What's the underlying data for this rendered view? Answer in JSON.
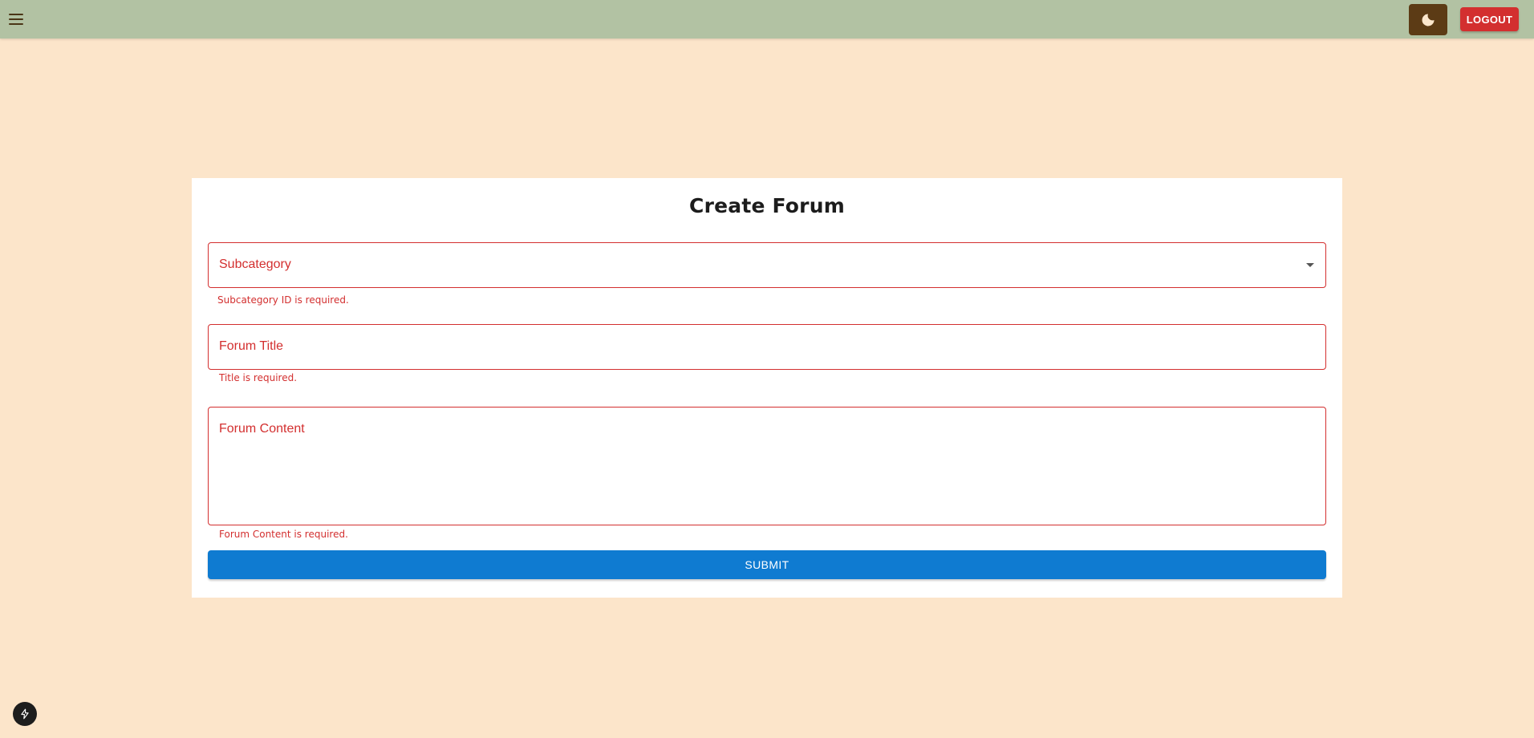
{
  "header": {
    "menu_icon": "hamburger-menu-icon",
    "theme_icon": "moon-icon",
    "logout_label": "LOGOUT",
    "background": "#b2c2a3",
    "theme_button_color": "#5c3b15",
    "logout_color": "#d32f2f"
  },
  "form": {
    "title": "Create Forum",
    "subcategory": {
      "label": "Subcategory",
      "value": "",
      "error": "Subcategory ID is required."
    },
    "forum_title": {
      "label": "Forum Title",
      "value": "",
      "error": "Title is required."
    },
    "forum_content": {
      "label": "Forum Content",
      "value": "",
      "error": "Forum Content is required."
    },
    "submit_label": "SUBMIT",
    "error_color": "#d32f2f",
    "submit_color": "#0f7bd1"
  },
  "page": {
    "background": "#fce5ca",
    "floating_icon": "lightning-bolt-icon"
  }
}
